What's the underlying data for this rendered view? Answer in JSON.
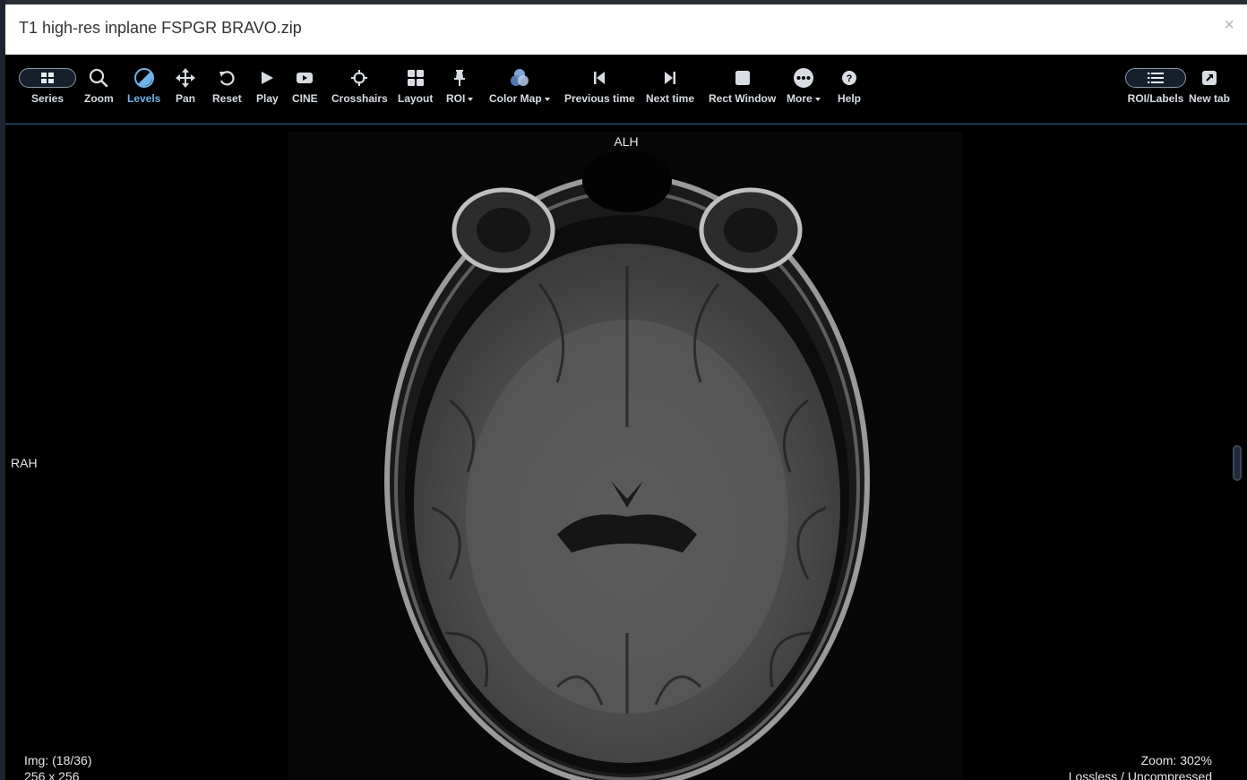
{
  "modal": {
    "title": "T1 high-res inplane FSPGR BRAVO.zip",
    "close_symbol": "×"
  },
  "toolbar": {
    "accent_color": "#6eb4ec",
    "tools": {
      "series": {
        "label": "Series",
        "icon": "grid-icon"
      },
      "zoom": {
        "label": "Zoom",
        "icon": "magnifier-icon"
      },
      "levels": {
        "label": "Levels",
        "icon": "contrast-circle-icon",
        "active": true
      },
      "pan": {
        "label": "Pan",
        "icon": "move-arrows-icon"
      },
      "reset": {
        "label": "Reset",
        "icon": "rotate-icon"
      },
      "play": {
        "label": "Play",
        "icon": "play-icon"
      },
      "cine": {
        "label": "CINE",
        "icon": "video-icon"
      },
      "crosshairs": {
        "label": "Crosshairs",
        "icon": "crosshairs-icon"
      },
      "layout": {
        "label": "Layout",
        "icon": "layout-grid-icon"
      },
      "roi": {
        "label": "ROI",
        "icon": "pin-icon",
        "dropdown": true
      },
      "color_map": {
        "label": "Color Map",
        "icon": "palette-icon",
        "dropdown": true
      },
      "previous_time": {
        "label": "Previous time",
        "icon": "step-backward-icon"
      },
      "next_time": {
        "label": "Next time",
        "icon": "step-forward-icon"
      },
      "rect_window": {
        "label": "Rect Window",
        "icon": "square-icon"
      },
      "more": {
        "label": "More",
        "icon": "ellipsis-circle-icon",
        "dropdown": true
      },
      "help": {
        "label": "Help",
        "icon": "question-circle-icon"
      },
      "roi_labels": {
        "label": "ROI/Labels",
        "icon": "list-icon"
      },
      "new_tab": {
        "label": "New tab",
        "icon": "external-link-icon"
      }
    }
  },
  "viewport": {
    "orientation_top": "ALH",
    "orientation_left": "RAH",
    "image_info": "Img: (18/36)",
    "matrix": "256 x 256",
    "zoom_text": "Zoom: 302%",
    "compression": "Lossless / Uncompressed"
  }
}
